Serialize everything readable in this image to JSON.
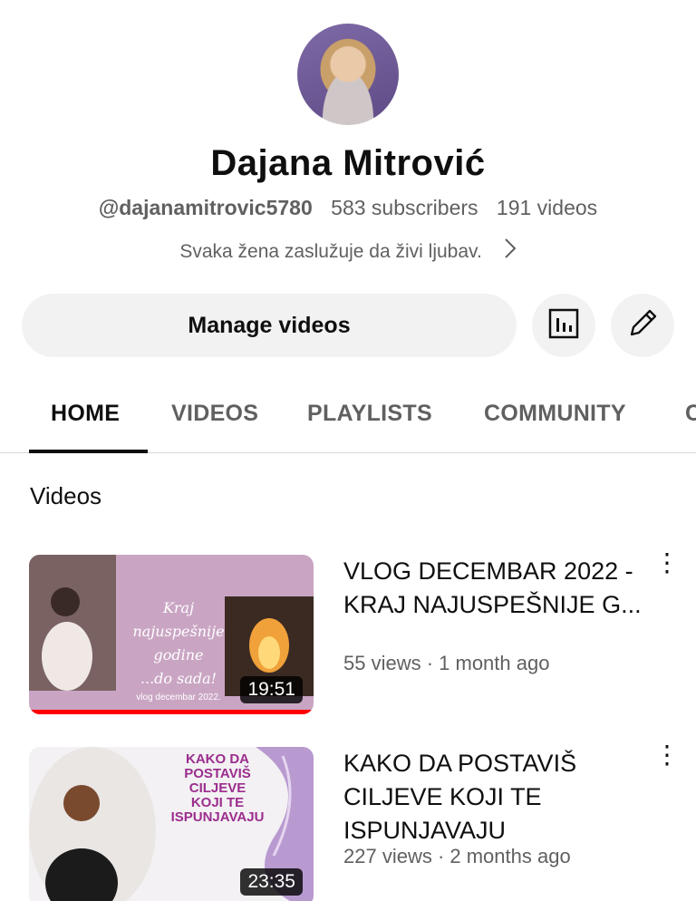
{
  "channel": {
    "name": "Dajana Mitrović",
    "handle": "@dajanamitrovic5780",
    "subscribers": "583 subscribers",
    "videos_count": "191 videos",
    "description": "Svaka žena zaslužuje da živi ljubav."
  },
  "actions": {
    "manage_label": "Manage videos",
    "analytics_icon": "bar-chart-icon",
    "edit_icon": "pencil-icon"
  },
  "tabs": [
    "HOME",
    "VIDEOS",
    "PLAYLISTS",
    "COMMUNITY",
    "C"
  ],
  "section": {
    "title": "Videos"
  },
  "videos": [
    {
      "title": "VLOG DECEMBAR 2022 - KRAJ NAJUSPEŠNIJE G...",
      "meta": "55 views · 1 month ago",
      "duration": "19:51",
      "thumb_text": [
        "Kraj",
        "najuspešnije godine",
        "...do sada!",
        "vlog decembar 2022."
      ],
      "watched_fraction": 1.0
    },
    {
      "title": "KAKO DA POSTAVIŠ CILJEVE KOJI TE ISPUNJAVAJU",
      "meta": "227 views · 2 months ago",
      "duration": "23:35",
      "thumb_text": [
        "KAKO DA",
        "POSTAVIŠ",
        "CILJEVE",
        "KOJI TE",
        "ISPUNJAVAJU"
      ]
    }
  ],
  "colors": {
    "accent_red": "#ff0000",
    "thumb1_bg": "#c9a5c3",
    "text_secondary": "#606060"
  }
}
